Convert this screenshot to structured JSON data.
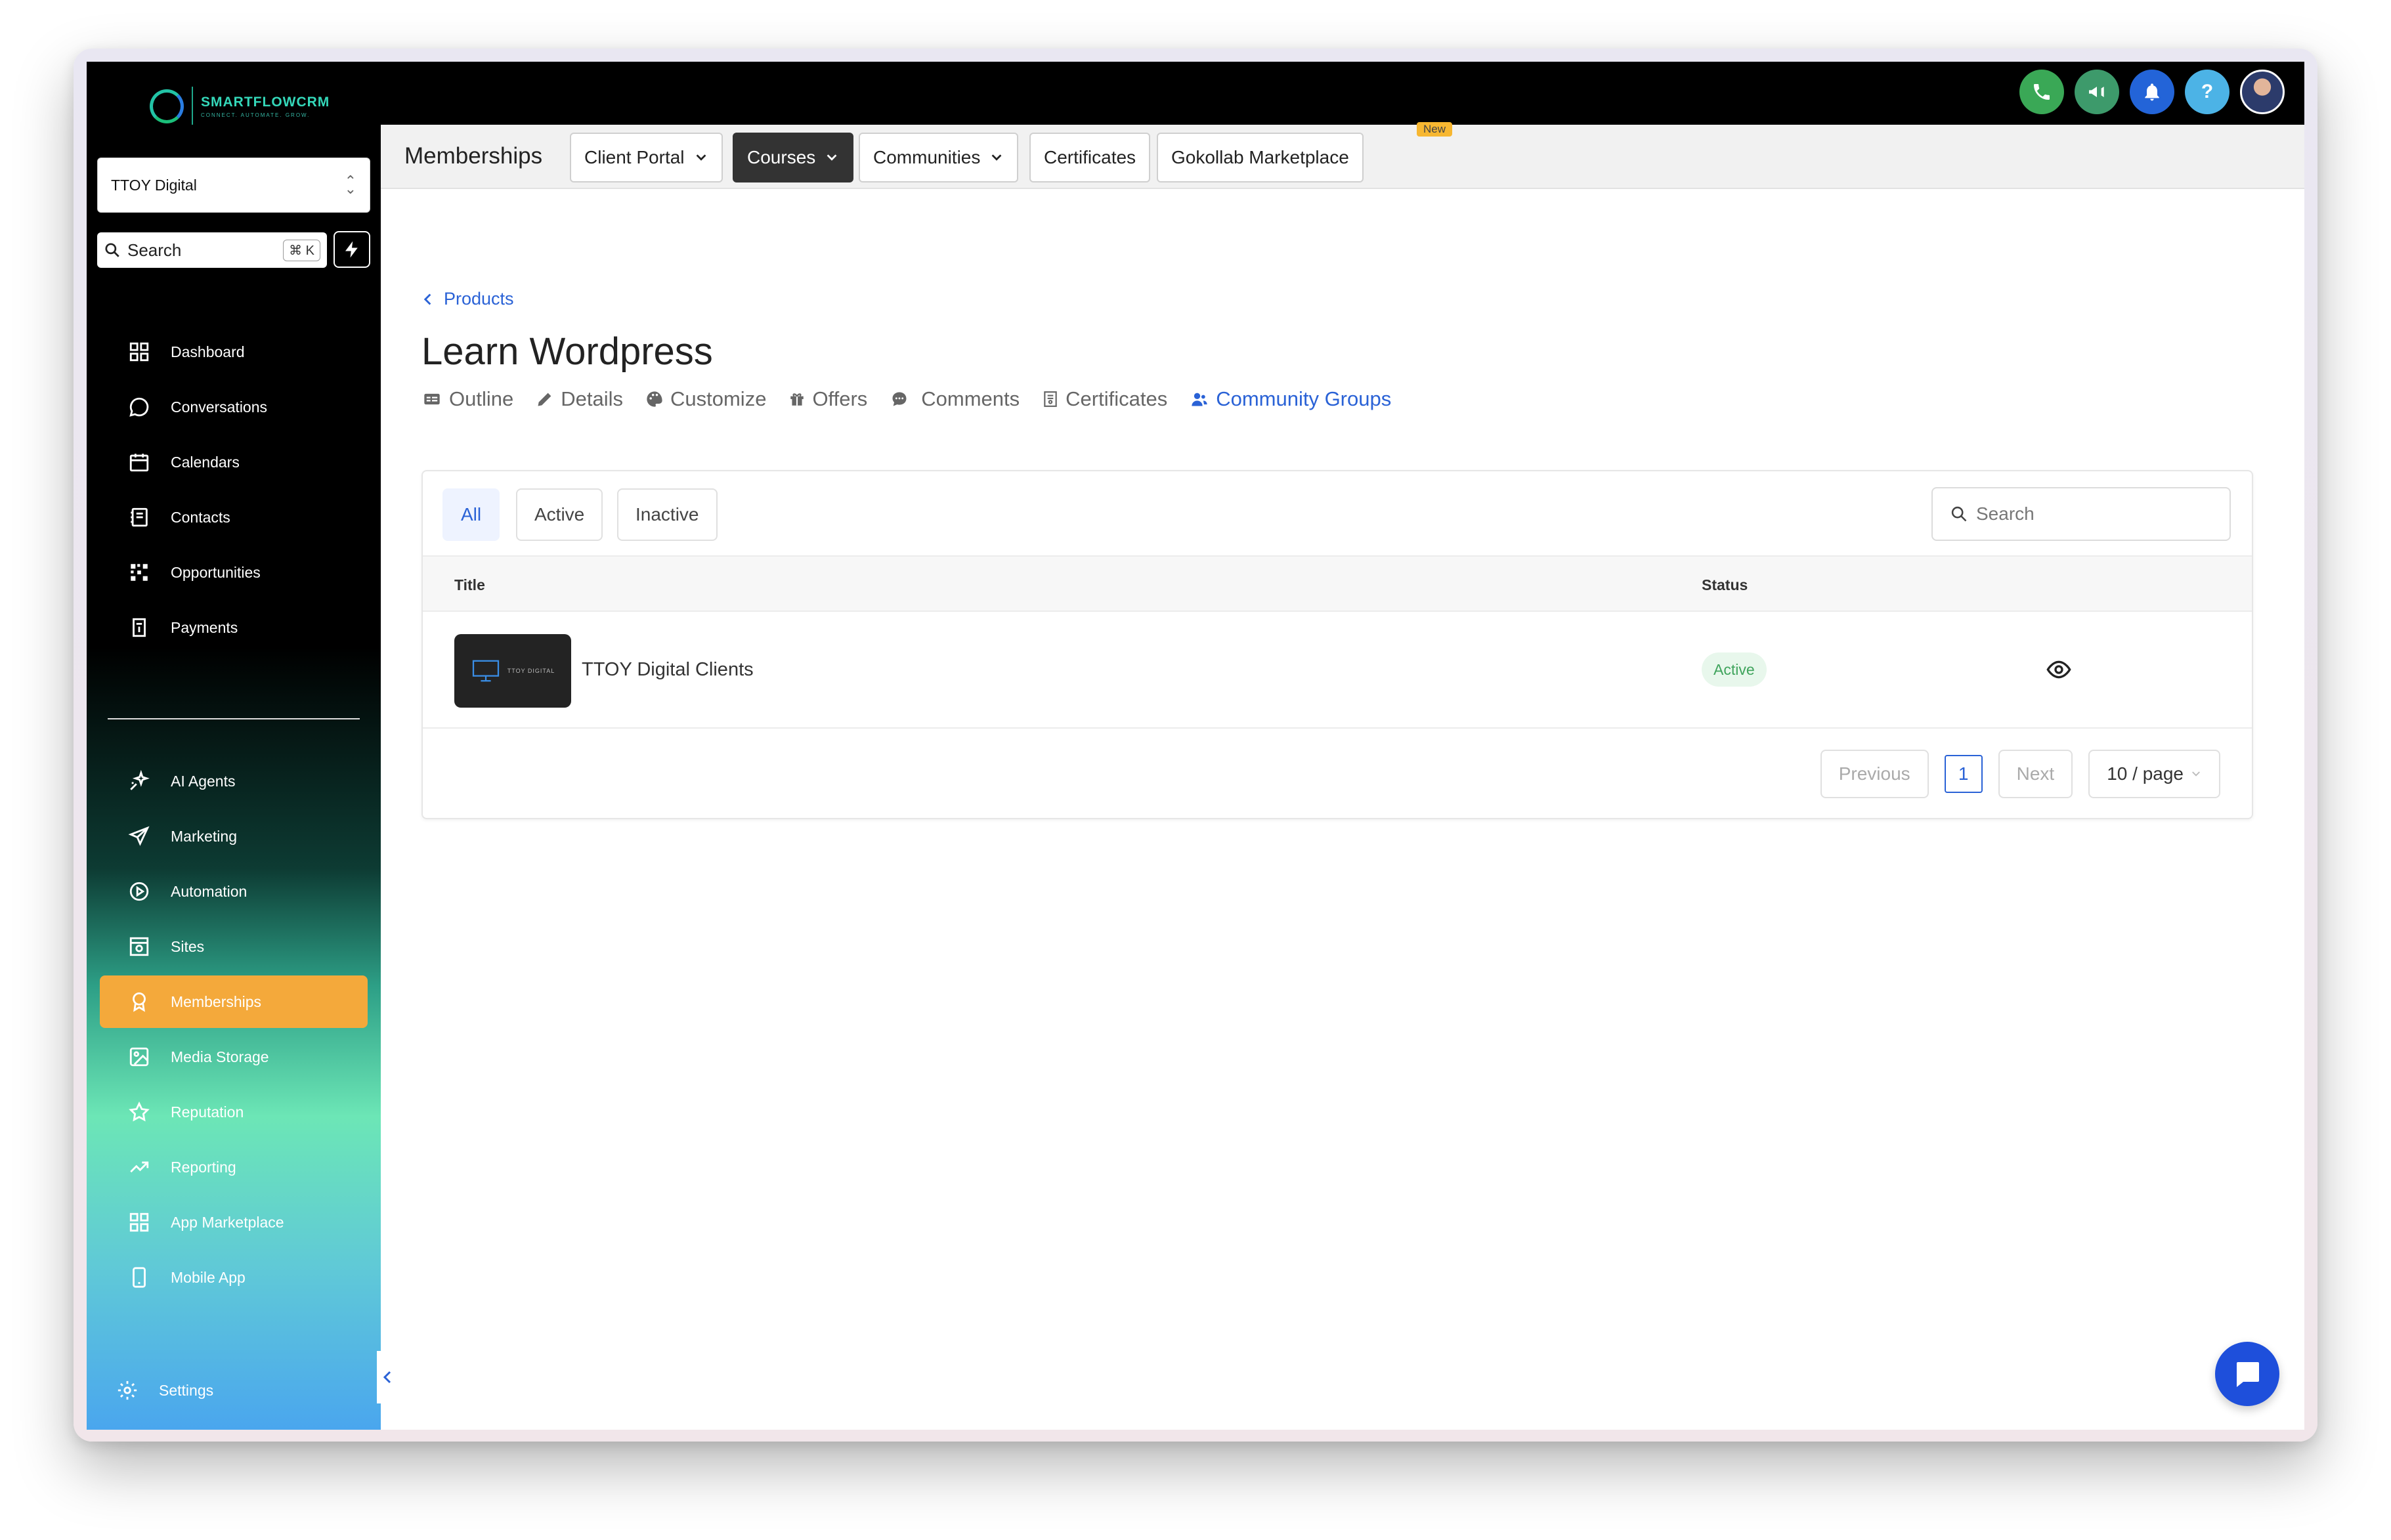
{
  "brand": {
    "name": "SMARTFLOWCRM",
    "tagline": "CONNECT. AUTOMATE. GROW."
  },
  "colors": {
    "accent": "#2a62d6",
    "active_nav": "#f4a93b",
    "topbar": "#000000",
    "status_active": "#3fa45c"
  },
  "account": {
    "name": "TTOY Digital"
  },
  "search": {
    "label": "Search",
    "shortcut": "⌘ K"
  },
  "sidebar": {
    "items": [
      {
        "label": "Dashboard",
        "icon": "grid-icon"
      },
      {
        "label": "Conversations",
        "icon": "chat-bubble-icon"
      },
      {
        "label": "Calendars",
        "icon": "calendar-icon"
      },
      {
        "label": "Contacts",
        "icon": "contact-book-icon"
      },
      {
        "label": "Opportunities",
        "icon": "pipeline-icon"
      },
      {
        "label": "Payments",
        "icon": "receipt-icon"
      },
      {
        "label": "AI Agents",
        "icon": "sparkle-icon"
      },
      {
        "label": "Marketing",
        "icon": "send-icon"
      },
      {
        "label": "Automation",
        "icon": "play-circle-icon"
      },
      {
        "label": "Sites",
        "icon": "sites-icon"
      },
      {
        "label": "Memberships",
        "icon": "award-icon"
      },
      {
        "label": "Media Storage",
        "icon": "image-icon"
      },
      {
        "label": "Reputation",
        "icon": "star-icon"
      },
      {
        "label": "Reporting",
        "icon": "trend-icon"
      },
      {
        "label": "App Marketplace",
        "icon": "apps-icon"
      },
      {
        "label": "Mobile App",
        "icon": "phone-device-icon"
      }
    ],
    "settings_label": "Settings"
  },
  "subnav": {
    "title": "Memberships",
    "tabs": [
      {
        "label": "Client Portal"
      },
      {
        "label": "Courses"
      },
      {
        "label": "Communities"
      },
      {
        "label": "Certificates"
      },
      {
        "label": "Gokollab Marketplace"
      }
    ],
    "new_badge": "New"
  },
  "breadcrumb": {
    "label": "Products"
  },
  "page": {
    "title": "Learn Wordpress"
  },
  "course_tabs": [
    {
      "label": "Outline"
    },
    {
      "label": "Details"
    },
    {
      "label": "Customize"
    },
    {
      "label": "Offers"
    },
    {
      "label": "Comments"
    },
    {
      "label": "Certificates"
    },
    {
      "label": "Community Groups"
    }
  ],
  "filters": {
    "all": "All",
    "active": "Active",
    "inactive": "Inactive"
  },
  "table_search": {
    "placeholder": "Search"
  },
  "table": {
    "columns": {
      "title": "Title",
      "status": "Status"
    },
    "rows": [
      {
        "title": "TTOY Digital Clients",
        "status": "Active",
        "thumb_text": "TTOY DIGITAL"
      }
    ]
  },
  "pagination": {
    "previous": "Previous",
    "page": "1",
    "next": "Next",
    "page_size": "10 / page"
  }
}
